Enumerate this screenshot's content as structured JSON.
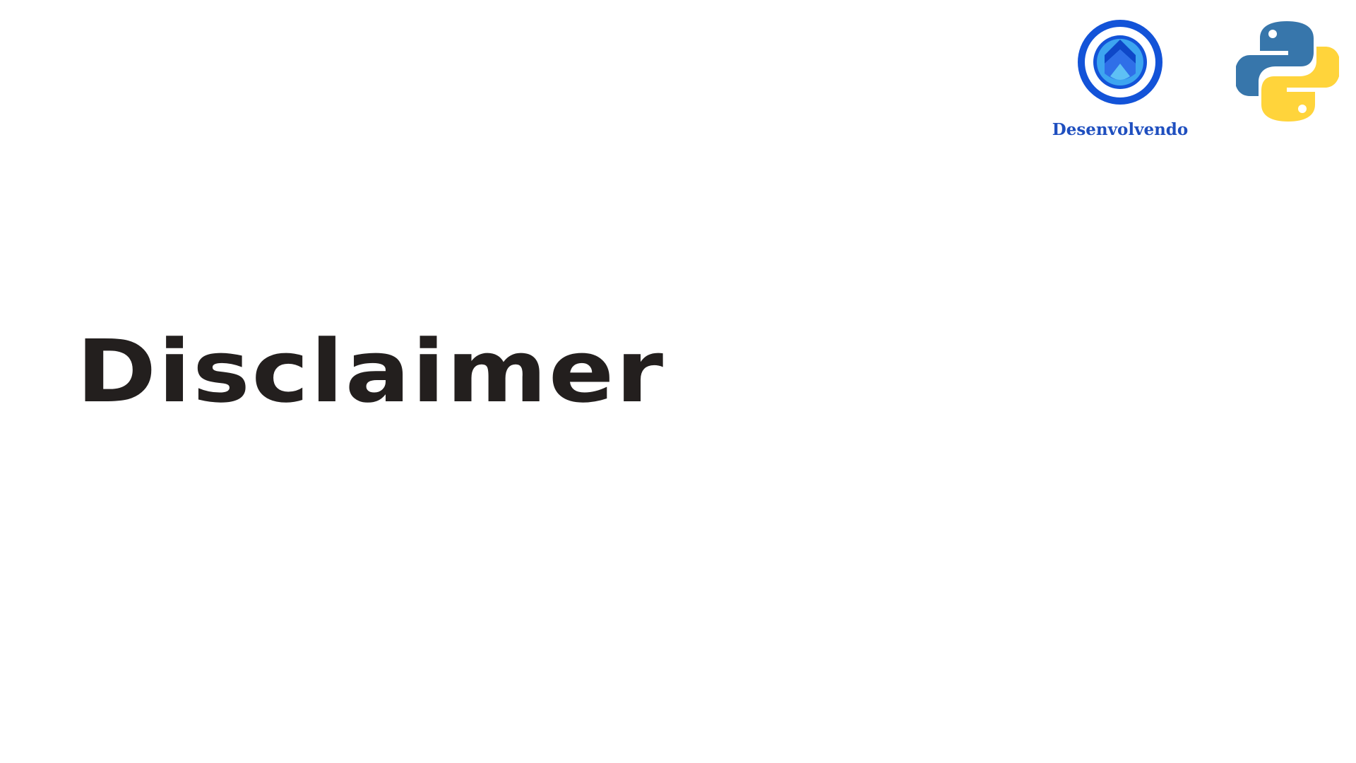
{
  "slide": {
    "title": "Disclaimer"
  },
  "logos": {
    "brand": {
      "icon": "desenvolvendo-logo-icon",
      "wordmark": "Desenvolvendo",
      "color": "#1f4fbf"
    },
    "python": {
      "icon": "python-logo-icon",
      "colors": [
        "#3776ab",
        "#ffd43b"
      ]
    }
  },
  "colors": {
    "background": "#ffffff",
    "title": "#231f1e"
  }
}
